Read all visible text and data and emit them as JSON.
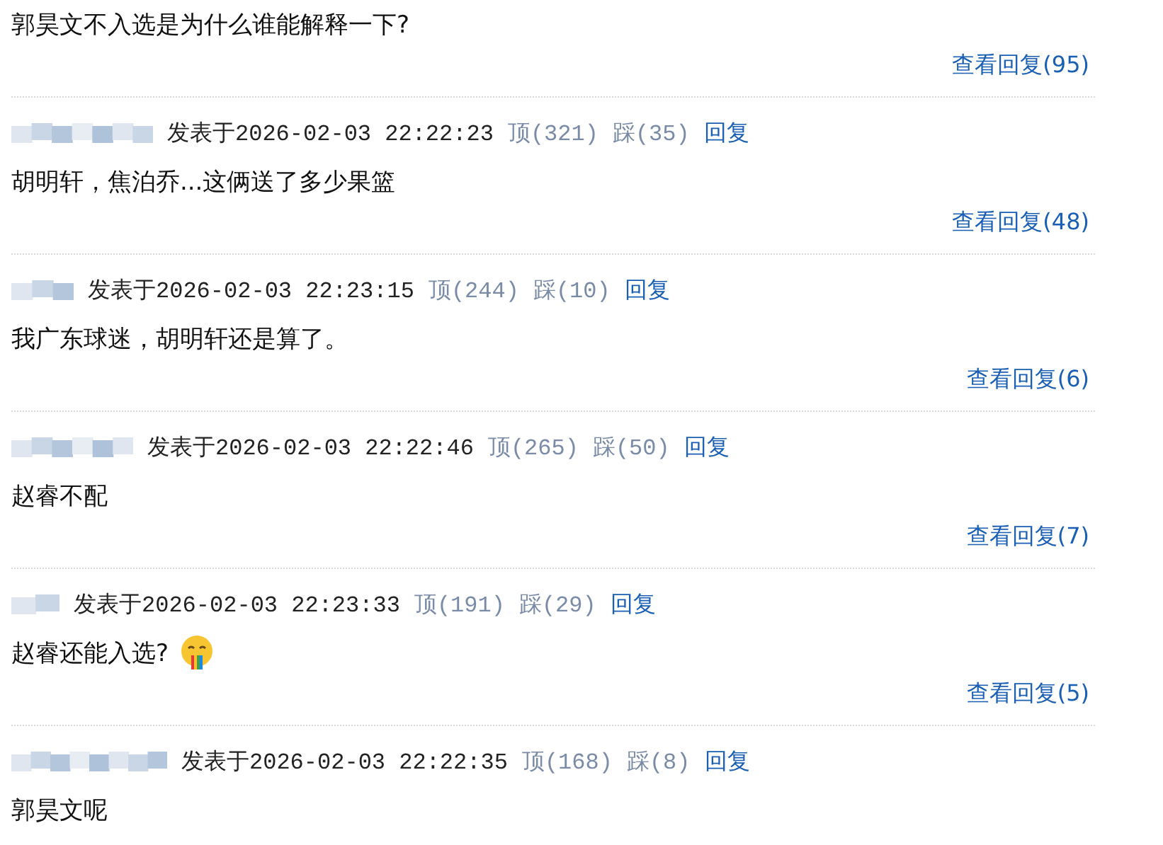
{
  "posts": [
    {
      "kind": "continued",
      "body": "郭昊文不入选是为什么谁能解释一下?",
      "replies_link": "查看回复(95)"
    },
    {
      "kind": "full",
      "meta": "发表于2026-02-03 22:22:23",
      "up": "顶(321)",
      "down": "踩(35)",
      "reply": "回复",
      "body": "胡明轩，焦泊乔...这俩送了多少果篮",
      "replies_link": "查看回复(48)"
    },
    {
      "kind": "full",
      "meta": "发表于2026-02-03 22:23:15",
      "up": "顶(244)",
      "down": "踩(10)",
      "reply": "回复",
      "body": "我广东球迷，胡明轩还是算了。",
      "replies_link": "查看回复(6)"
    },
    {
      "kind": "full",
      "meta": "发表于2026-02-03 22:22:46",
      "up": "顶(265)",
      "down": "踩(50)",
      "reply": "回复",
      "body": "赵睿不配",
      "replies_link": "查看回复(7)"
    },
    {
      "kind": "full",
      "meta": "发表于2026-02-03 22:23:33",
      "up": "顶(191)",
      "down": "踩(29)",
      "reply": "回复",
      "body": "赵睿还能入选?",
      "emoji": true,
      "replies_link": "查看回复(5)"
    },
    {
      "kind": "full",
      "meta": "发表于2026-02-03 22:22:35",
      "up": "顶(168)",
      "down": "踩(8)",
      "reply": "回复",
      "body": "郭昊文呢"
    }
  ]
}
